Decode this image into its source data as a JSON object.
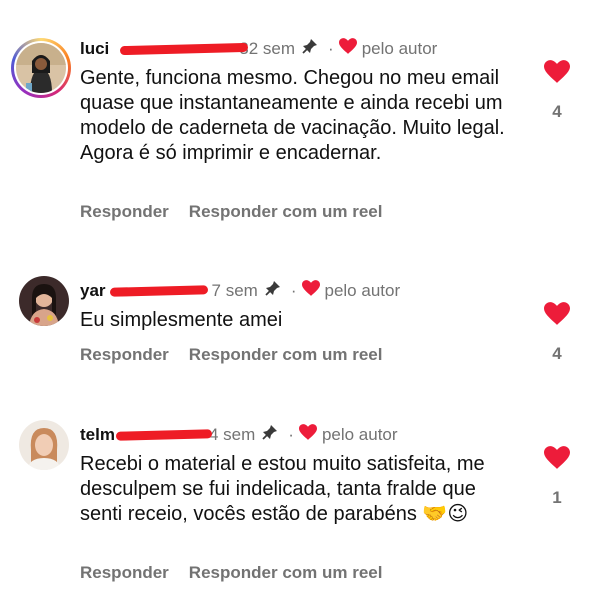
{
  "comments": [
    {
      "username": "luci",
      "time": "32 sem",
      "author_label": "pelo autor",
      "text": "Gente, funciona mesmo. Chegou no meu email quase que instantaneamente e ainda recebi um modelo de caderneta de vacinação. Muito legal. Agora é  só imprimir e encadernar.",
      "reply_label": "Responder",
      "reel_label": "Responder com um reel",
      "likes": "4"
    },
    {
      "username": "yar",
      "time": "7 sem",
      "author_label": "pelo autor",
      "text": "Eu simplesmente amei",
      "reply_label": "Responder",
      "reel_label": "Responder com um reel",
      "likes": "4"
    },
    {
      "username": "telm",
      "time": "4 sem",
      "author_label": "pelo autor",
      "text": "Recebi o material e estou muito satisfeita, me desculpem se fui indelicada, tanta fralde que senti receio, vocês estão de parabéns 🤝😉",
      "reply_label": "Responder",
      "reel_label": "Responder com um reel",
      "likes": "1"
    }
  ],
  "colors": {
    "heart": "#ed1c3a",
    "muted": "#737373",
    "redaction": "#ee1c25"
  }
}
